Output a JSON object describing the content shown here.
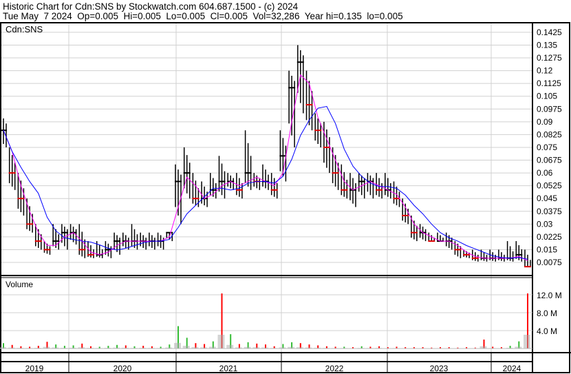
{
  "header": {
    "title": "Historic Chart for Cdn:SNS by Stockwatch.com 604.687.1500 - (c) 2024",
    "quote": "Tue May  7 2024  Op=0.005  Hi=0.005  Lo=0.005  Cl=0.005  Vol=32,286  Year hi=0.135  lo=0.005"
  },
  "chart_data": [
    {
      "type": "line",
      "title": "Cdn:SNS",
      "ylim": [
        0.0,
        0.15
      ],
      "yticks": [
        "0.1425",
        "0.135",
        "0.1275",
        "0.12",
        "0.1125",
        "0.105",
        "0.0975",
        "0.09",
        "0.0825",
        "0.075",
        "0.0675",
        "0.06",
        "0.0525",
        "0.045",
        "0.0375",
        "0.03",
        "0.0225",
        "0.015",
        "0.0075"
      ],
      "start_month": "2019-05",
      "high": [
        0.095,
        0.075,
        0.06,
        0.045,
        0.03,
        0.02,
        0.03,
        0.03,
        0.03,
        0.03,
        0.02,
        0.02,
        0.02,
        0.025,
        0.025,
        0.03,
        0.025,
        0.025,
        0.025,
        0.025,
        0.065,
        0.075,
        0.06,
        0.055,
        0.06,
        0.07,
        0.06,
        0.06,
        0.085,
        0.06,
        0.065,
        0.06,
        0.085,
        0.12,
        0.135,
        0.12,
        0.095,
        0.09,
        0.075,
        0.065,
        0.06,
        0.06,
        0.06,
        0.06,
        0.06,
        0.055,
        0.045,
        0.035,
        0.03,
        0.025,
        0.025,
        0.025,
        0.02,
        0.015,
        0.015,
        0.015,
        0.015,
        0.015,
        0.02,
        0.02,
        0.015
      ],
      "low": [
        0.075,
        0.05,
        0.035,
        0.025,
        0.015,
        0.012,
        0.015,
        0.015,
        0.018,
        0.01,
        0.01,
        0.01,
        0.01,
        0.012,
        0.015,
        0.015,
        0.015,
        0.015,
        0.015,
        0.02,
        0.03,
        0.045,
        0.04,
        0.04,
        0.045,
        0.045,
        0.05,
        0.045,
        0.05,
        0.05,
        0.05,
        0.045,
        0.055,
        0.075,
        0.095,
        0.085,
        0.075,
        0.06,
        0.05,
        0.045,
        0.04,
        0.045,
        0.045,
        0.045,
        0.045,
        0.04,
        0.03,
        0.02,
        0.02,
        0.02,
        0.02,
        0.015,
        0.01,
        0.01,
        0.008,
        0.008,
        0.008,
        0.008,
        0.008,
        0.008,
        0.005
      ],
      "close": [
        0.085,
        0.06,
        0.045,
        0.03,
        0.02,
        0.015,
        0.02,
        0.025,
        0.025,
        0.015,
        0.012,
        0.012,
        0.015,
        0.02,
        0.02,
        0.02,
        0.02,
        0.02,
        0.02,
        0.025,
        0.055,
        0.06,
        0.045,
        0.045,
        0.05,
        0.055,
        0.055,
        0.05,
        0.06,
        0.055,
        0.055,
        0.05,
        0.07,
        0.11,
        0.125,
        0.1,
        0.085,
        0.075,
        0.06,
        0.05,
        0.05,
        0.055,
        0.055,
        0.05,
        0.05,
        0.045,
        0.035,
        0.025,
        0.025,
        0.02,
        0.02,
        0.02,
        0.015,
        0.012,
        0.01,
        0.01,
        0.01,
        0.01,
        0.01,
        0.012,
        0.005
      ],
      "series": [
        {
          "name": "Price",
          "color": "#000000"
        },
        {
          "name": "Short MA",
          "color": "#ff00ff"
        },
        {
          "name": "Long MA",
          "color": "#0000ff"
        }
      ]
    },
    {
      "type": "bar",
      "title": "Volume",
      "yticks": [
        "12.0 M",
        "8.0 M",
        "4.0 M"
      ],
      "ylim": [
        0,
        14
      ],
      "unit": "M",
      "values": [
        1.2,
        0.8,
        0.5,
        0.4,
        0.6,
        1.5,
        0.9,
        0.6,
        0.7,
        1.1,
        0.5,
        0.4,
        0.6,
        0.8,
        0.7,
        0.5,
        0.6,
        0.5,
        0.4,
        0.9,
        5.0,
        2.4,
        1.2,
        1.0,
        1.6,
        12.3,
        3.2,
        1.0,
        1.4,
        1.1,
        0.9,
        0.5,
        1.0,
        1.4,
        1.2,
        0.9,
        0.7,
        0.5,
        0.4,
        0.4,
        0.3,
        0.5,
        0.4,
        0.5,
        0.3,
        0.4,
        0.3,
        0.3,
        0.3,
        0.2,
        0.3,
        0.3,
        0.2,
        0.3,
        0.2,
        2.0,
        0.4,
        0.3,
        0.6,
        1.6,
        12.3
      ],
      "colors": [
        "green",
        "red",
        "red",
        "red",
        "red",
        "red",
        "green",
        "green",
        "green",
        "red",
        "red",
        "green",
        "green",
        "green",
        "red",
        "green",
        "red",
        "red",
        "green",
        "green",
        "green",
        "green",
        "red",
        "red",
        "green",
        "red",
        "green",
        "red",
        "green",
        "red",
        "red",
        "red",
        "green",
        "green",
        "red",
        "red",
        "red",
        "red",
        "red",
        "green",
        "red",
        "green",
        "red",
        "red",
        "red",
        "red",
        "red",
        "red",
        "red",
        "red",
        "red",
        "red",
        "red",
        "red",
        "red",
        "red",
        "red",
        "red",
        "green",
        "green",
        "red"
      ]
    },
    {
      "type": "axis",
      "xticks": [
        "2019",
        "2020",
        "2021",
        "2022",
        "2023",
        "2024"
      ]
    }
  ]
}
